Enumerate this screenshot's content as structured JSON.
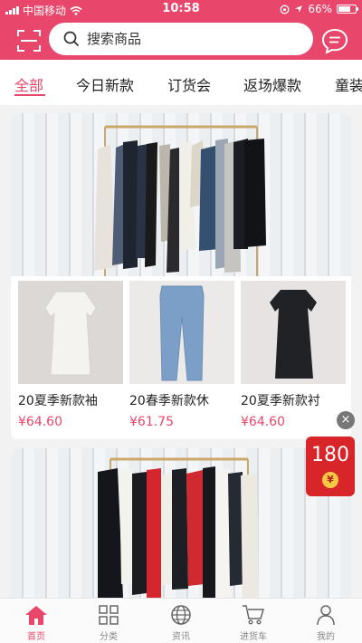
{
  "status_bar": {
    "carrier": "中国移动",
    "time": "10:58",
    "battery": "66%"
  },
  "search": {
    "placeholder": "搜索商品"
  },
  "tabs": [
    {
      "label": "全部",
      "active": true
    },
    {
      "label": "今日新款"
    },
    {
      "label": "订货会"
    },
    {
      "label": "返场爆款"
    },
    {
      "label": "童装"
    }
  ],
  "section1": {
    "products": [
      {
        "name": "20夏季新款袖",
        "price": "¥64.60",
        "icon": "white-dress-image"
      },
      {
        "name": "20春季新款休",
        "price": "¥61.75",
        "icon": "jeans-image"
      },
      {
        "name": "20夏季新款衬",
        "price": "¥64.60",
        "icon": "black-dress-image"
      }
    ]
  },
  "floating": {
    "coupon_value": "180",
    "coupon_currency": "¥",
    "close_symbol": "×"
  },
  "bottom_nav": [
    {
      "label": "首页",
      "icon": "home-icon",
      "active": true
    },
    {
      "label": "分类",
      "icon": "grid-icon"
    },
    {
      "label": "资讯",
      "icon": "globe-icon"
    },
    {
      "label": "进货车",
      "icon": "cart-icon"
    },
    {
      "label": "我的",
      "icon": "user-icon"
    }
  ],
  "colors": {
    "accent": "#e8466a",
    "coupon": "#d8252a"
  }
}
